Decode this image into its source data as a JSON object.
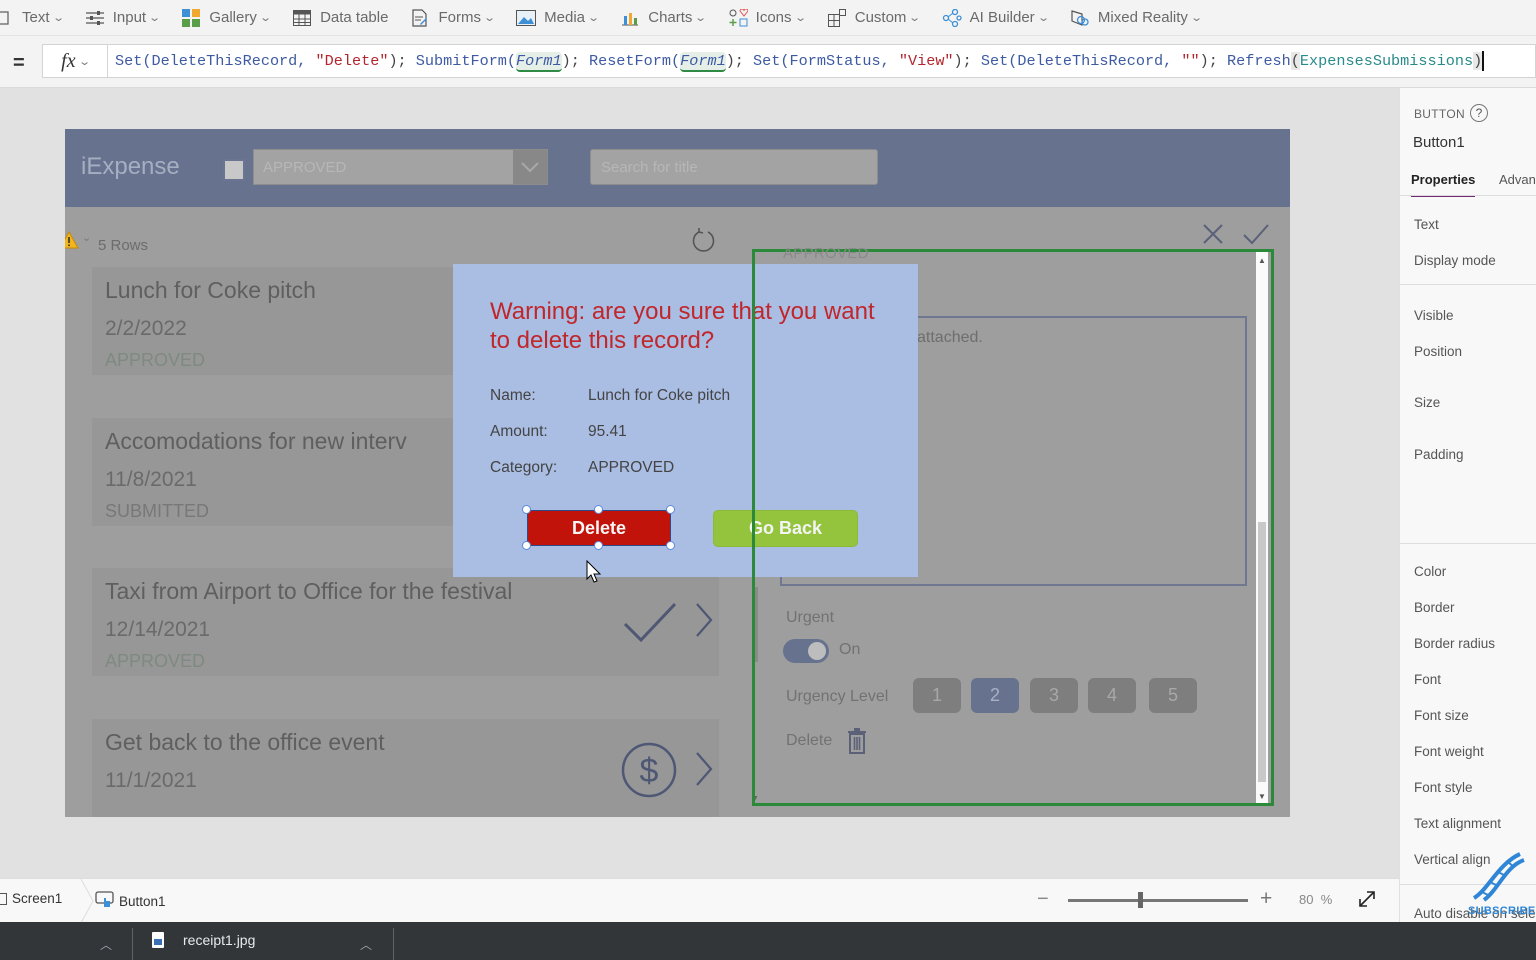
{
  "ribbon": {
    "items": [
      {
        "label": "Text",
        "icon": "text-icon",
        "dropdown": true
      },
      {
        "label": "Input",
        "icon": "input-sliders-icon",
        "dropdown": true
      },
      {
        "label": "Gallery",
        "icon": "gallery-icon",
        "dropdown": true
      },
      {
        "label": "Data table",
        "icon": "data-table-icon",
        "dropdown": false
      },
      {
        "label": "Forms",
        "icon": "forms-icon",
        "dropdown": true
      },
      {
        "label": "Media",
        "icon": "media-icon",
        "dropdown": true
      },
      {
        "label": "Charts",
        "icon": "charts-icon",
        "dropdown": true
      },
      {
        "label": "Icons",
        "icon": "icons-icon",
        "dropdown": true
      },
      {
        "label": "Custom",
        "icon": "custom-icon",
        "dropdown": true
      },
      {
        "label": "AI Builder",
        "icon": "ai-builder-icon",
        "dropdown": true
      },
      {
        "label": "Mixed Reality",
        "icon": "mixed-reality-icon",
        "dropdown": true
      }
    ]
  },
  "formula_bar": {
    "equals": "=",
    "fx_label": "fx",
    "tokens": {
      "t1": "Set(DeleteThisRecord, ",
      "t2": "\"Delete\"",
      "t3": "); ",
      "t4": "SubmitForm(",
      "t5": "Form1",
      "t6": "); ",
      "t7": "ResetForm(",
      "t8": "Form1",
      "t9": "); ",
      "t10": "Set(FormStatus, ",
      "t11": "\"View\"",
      "t12": "); ",
      "t13": "Set(DeleteThisRecord, ",
      "t14": "\"\"",
      "t15": "); ",
      "t16": "Refresh",
      "t17": "(",
      "t18": "ExpensesSubmissions",
      "t19": ")"
    }
  },
  "app": {
    "title": "iExpense",
    "filter_dropdown_value": "APPROVED",
    "search_placeholder": "Search for title",
    "rows_label": "5 Rows",
    "gallery": [
      {
        "title": "Lunch for Coke pitch",
        "date": "2/2/2022",
        "status": "APPROVED"
      },
      {
        "title": "Accomodations for new interv",
        "date": "11/8/2021",
        "status": "SUBMITTED"
      },
      {
        "title": "Taxi from Airport to Office for the festival",
        "date": "12/14/2021",
        "status": "APPROVED",
        "icon": "checkmark-icon"
      },
      {
        "title": "Get back to the office event",
        "date": "11/1/2021",
        "status": "",
        "icon": "dollar-icon"
      }
    ],
    "form": {
      "status_text": "APPROVED",
      "attachment_text": "attached.",
      "urgent_label": "Urgent",
      "toggle_state": "On",
      "urgency_label": "Urgency Level",
      "urgency_levels": [
        "1",
        "2",
        "3",
        "4",
        "5"
      ],
      "urgency_selected": "2",
      "delete_label": "Delete"
    }
  },
  "dialog": {
    "warning": "Warning: are you sure that you want to delete this record?",
    "fields": [
      {
        "label": "Name:",
        "value": "Lunch for Coke pitch"
      },
      {
        "label": "Amount:",
        "value": "95.41"
      },
      {
        "label": "Category:",
        "value": "APPROVED"
      }
    ],
    "delete_button": "Delete",
    "goback_button": "Go Back"
  },
  "properties_panel": {
    "type": "BUTTON",
    "name": "Button1",
    "tabs": [
      "Properties",
      "Advanced"
    ],
    "group1": [
      "Text",
      "Display mode"
    ],
    "group2": [
      "Visible",
      "Position",
      "Size",
      "Padding"
    ],
    "group3": [
      "Color",
      "Border",
      "Border radius",
      "Font",
      "Font size",
      "Font weight",
      "Font style",
      "Text alignment",
      "Vertical align"
    ],
    "group4": [
      "Auto disable on select"
    ]
  },
  "statusbar": {
    "screen": "Screen1",
    "control": "Button1",
    "zoom_value": "80",
    "zoom_unit": "%",
    "zoom_percent": 80
  },
  "downloads": {
    "file": "receipt1.jpg"
  },
  "watermark": {
    "text": "SUBSCRIBE"
  },
  "colors": {
    "delete_button": "#c2130b",
    "goback_button": "#94c43e",
    "dialog_bg": "#aabde3",
    "warning_text": "#c0262a",
    "app_header": "#66728e",
    "selection_outline": "#2a8a3a"
  }
}
